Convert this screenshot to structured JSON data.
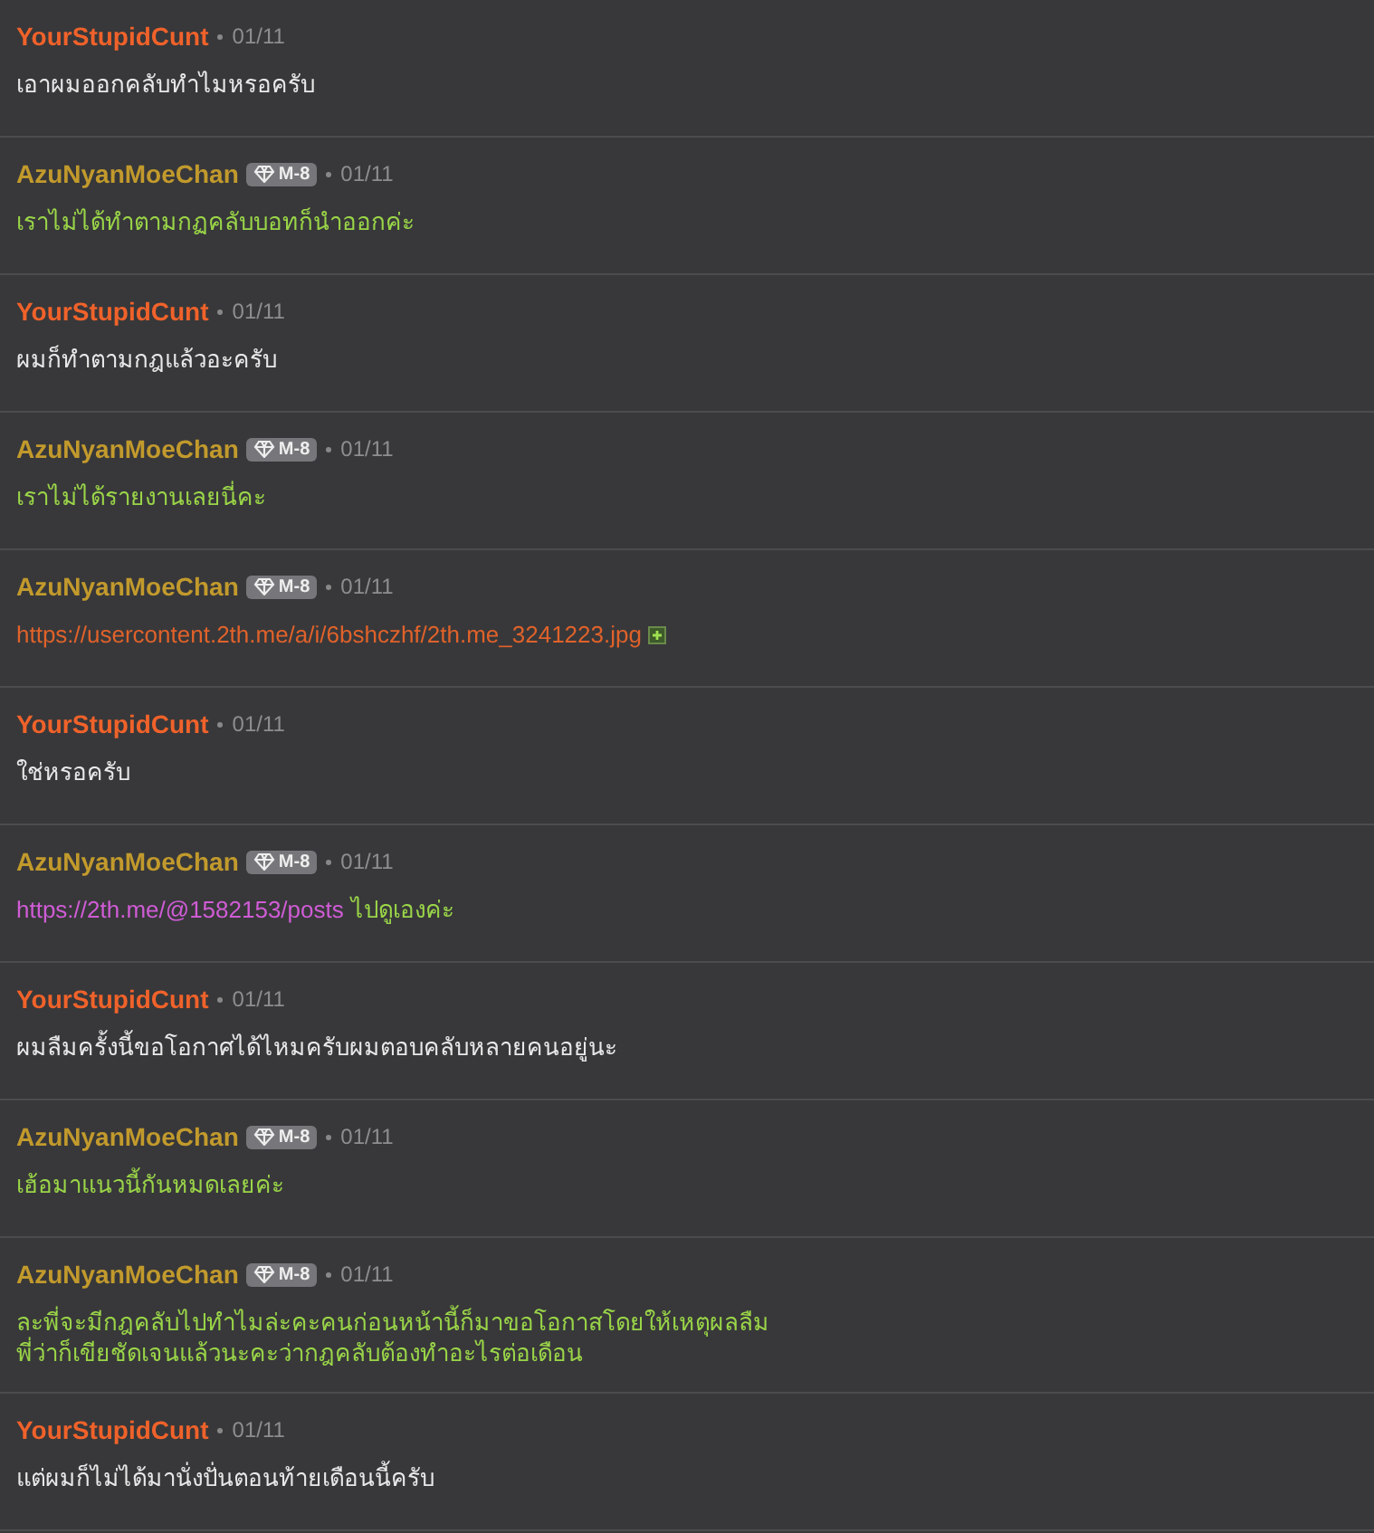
{
  "messages": [
    {
      "author": "YourStupidCunt",
      "kind": "member",
      "date": "01/11",
      "body": [
        {
          "kind": "text",
          "text": "เอาผมออกคลับทำไมหรอครับ"
        }
      ]
    },
    {
      "author": "AzuNyanMoeChan",
      "kind": "moderator",
      "badge": "M-8",
      "date": "01/11",
      "body": [
        {
          "kind": "text",
          "text": "เราไม่ได้ทำตามกฏคลับบอทก็นำออกค่ะ"
        }
      ]
    },
    {
      "author": "YourStupidCunt",
      "kind": "member",
      "date": "01/11",
      "body": [
        {
          "kind": "text",
          "text": "ผมก็ทำตามกฎแล้วอะครับ"
        }
      ]
    },
    {
      "author": "AzuNyanMoeChan",
      "kind": "moderator",
      "badge": "M-8",
      "date": "01/11",
      "body": [
        {
          "kind": "text",
          "text": "เราไม่ได้รายงานเลยนี่คะ"
        }
      ]
    },
    {
      "author": "AzuNyanMoeChan",
      "kind": "moderator",
      "badge": "M-8",
      "date": "01/11",
      "body": [
        {
          "kind": "link",
          "text": "https://usercontent.2th.me/a/i/6bshczhf/2th.me_3241223.jpg",
          "color": "#e0622a"
        },
        {
          "kind": "expand"
        }
      ]
    },
    {
      "author": "YourStupidCunt",
      "kind": "member",
      "date": "01/11",
      "body": [
        {
          "kind": "text",
          "text": "ใช่หรอครับ"
        }
      ]
    },
    {
      "author": "AzuNyanMoeChan",
      "kind": "moderator",
      "badge": "M-8",
      "date": "01/11",
      "body": [
        {
          "kind": "link",
          "text": "https://2th.me/@1582153/posts",
          "color": "#d05cd6"
        },
        {
          "kind": "text",
          "text": "ไปดูเองค่ะ"
        }
      ]
    },
    {
      "author": "YourStupidCunt",
      "kind": "member",
      "date": "01/11",
      "body": [
        {
          "kind": "text",
          "text": "ผมลืมครั้งนี้ขอโอกาศได้ไหมครับผมตอบคลับหลายคนอยู่นะ"
        }
      ]
    },
    {
      "author": "AzuNyanMoeChan",
      "kind": "moderator",
      "badge": "M-8",
      "date": "01/11",
      "body": [
        {
          "kind": "text",
          "text": "เฮ้อมาแนวนี้กันหมดเลยค่ะ"
        }
      ]
    },
    {
      "author": "AzuNyanMoeChan",
      "kind": "moderator",
      "badge": "M-8",
      "date": "01/11",
      "body": [
        {
          "kind": "text",
          "text": "ละพี่จะมีกฎคลับไปทำไมล่ะคะคนก่อนหน้านี้ก็มาขอโอกาสโดยให้เหตุผลลืม"
        },
        {
          "kind": "break"
        },
        {
          "kind": "text",
          "text": "พี่ว่าก็เขียชัดเจนแล้วนะคะว่ากฎคลับต้องทำอะไรต่อเดือน"
        }
      ]
    },
    {
      "author": "YourStupidCunt",
      "kind": "member",
      "date": "01/11",
      "body": [
        {
          "kind": "text",
          "text": "แต่ผมก็ไม่ได้มานั่งปั่นตอนท้ายเดือนนี้ครับ"
        }
      ]
    }
  ]
}
